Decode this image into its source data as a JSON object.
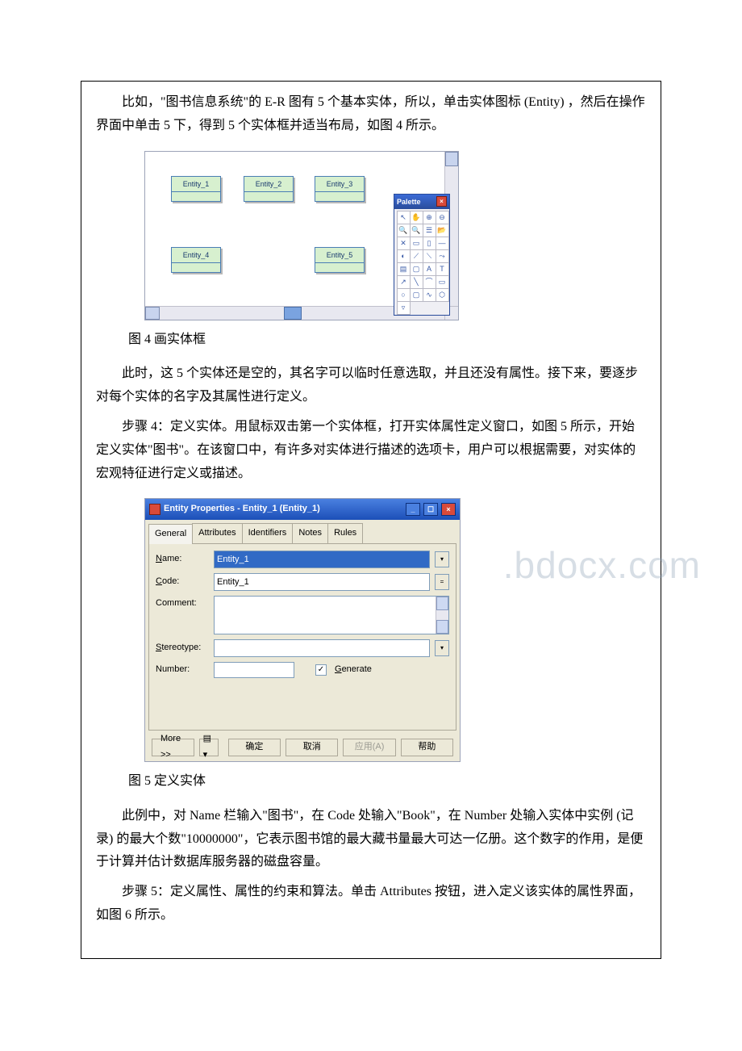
{
  "para1": "比如，\"图书信息系统\"的 E-R 图有 5 个基本实体，所以，单击实体图标 (Entity) ，然后在操作界面中单击 5 下，得到 5 个实体框并适当布局，如图 4 所示。",
  "fig4": {
    "entities": [
      "Entity_1",
      "Entity_2",
      "Entity_3",
      "Entity_4",
      "Entity_5"
    ],
    "palette_title": "Palette"
  },
  "cap4": "图 4 画实体框",
  "para2": "此时，这 5 个实体还是空的，其名字可以临时任意选取，并且还没有属性。接下来，要逐步对每个实体的名字及其属性进行定义。",
  "para3": "步骤 4：定义实体。用鼠标双击第一个实体框，打开实体属性定义窗口，如图 5 所示，开始定义实体\"图书\"。在该窗口中，有许多对实体进行描述的选项卡，用户可以根据需要，对实体的宏观特征进行定义或描述。",
  "fig5": {
    "title": "Entity Properties - Entity_1 (Entity_1)",
    "tabs": [
      "General",
      "Attributes",
      "Identifiers",
      "Notes",
      "Rules"
    ],
    "labels": {
      "name": "Name:",
      "code": "Code:",
      "comment": "Comment:",
      "stereotype": "Stereotype:",
      "number": "Number:",
      "generate": "Generate"
    },
    "values": {
      "name": "Entity_1",
      "code": "Entity_1"
    },
    "buttons": {
      "more": "More >>",
      "ok": "确定",
      "cancel": "取消",
      "apply": "应用(A)",
      "help": "帮助"
    }
  },
  "cap5": "图 5 定义实体",
  "para4": "此例中，对 Name 栏输入\"图书\"，在 Code 处输入\"Book\"，在 Number 处输入实体中实例 (记录) 的最大个数\"10000000\"，它表示图书馆的最大藏书量最大可达一亿册。这个数字的作用，是便于计算并估计数据库服务器的磁盘容量。",
  "para5": "步骤 5：定义属性、属性的约束和算法。单击 Attributes 按钮，进入定义该实体的属性界面，如图 6 所示。",
  "watermark": ".bdocx.com"
}
